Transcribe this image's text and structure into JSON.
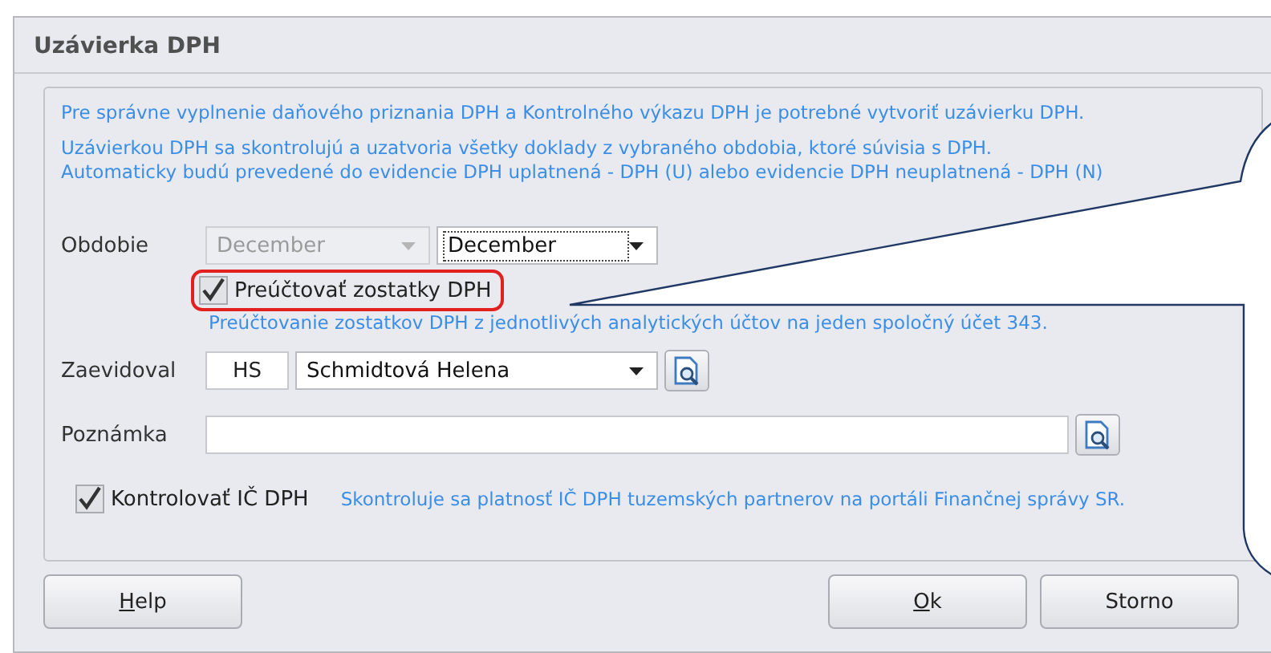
{
  "window": {
    "title": "Uzávierka DPH"
  },
  "info_lines": [
    "Pre správne vyplnenie daňového priznania DPH a Kontrolného výkazu DPH je potrebné vytvoriť uzávierku DPH.",
    "Uzávierkou DPH sa skontrolujú a uzatvoria všetky doklady z vybraného obdobia, ktoré súvisia s DPH.",
    "Automaticky budú prevedené do evidencie DPH uplatnená - DPH (U) alebo evidencie DPH neuplatnená - DPH (N)"
  ],
  "period": {
    "label": "Obdobie",
    "from": {
      "value": "December",
      "disabled": true
    },
    "to": {
      "value": "December",
      "disabled": false
    }
  },
  "rebook": {
    "label": "Preúčtovať zostatky DPH",
    "checked": true,
    "highlighted": true,
    "hint": "Preúčtovanie zostatkov DPH z jednotlivých analytických účtov na jeden spoločný účet 343."
  },
  "recorded_by": {
    "label": "Zaevidoval",
    "code": "HS",
    "name": "Schmidtová Helena"
  },
  "note": {
    "label": "Poznámka"
  },
  "check_vat": {
    "label": "Kontrolovať IČ DPH",
    "checked": true,
    "hint": "Skontroluje sa platnosť IČ DPH tuzemských partnerov na portáli Finančnej správy SR."
  },
  "buttons": [
    {
      "label": "Help",
      "mnemonic_underlined": true
    },
    {
      "label": "Ok",
      "mnemonic_underlined": true
    },
    {
      "label": "Storno",
      "mnemonic_underlined": false
    }
  ]
}
